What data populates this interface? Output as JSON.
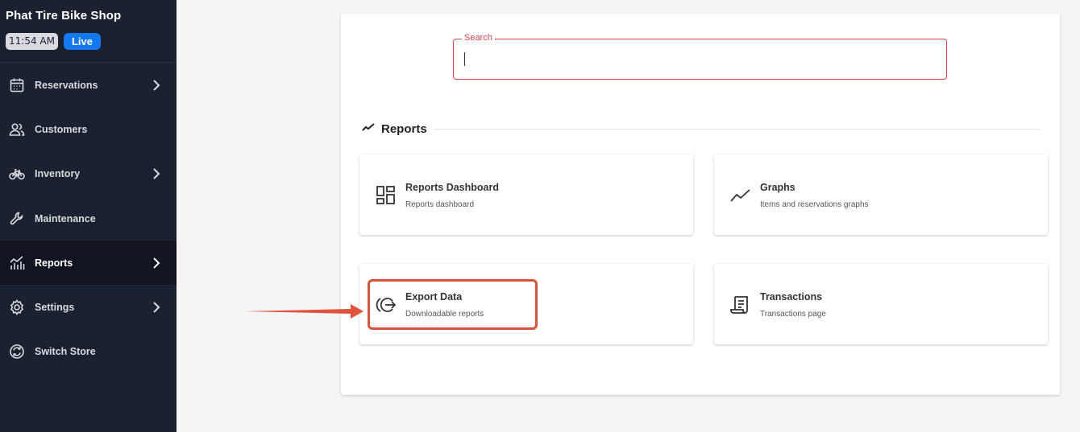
{
  "sidebar": {
    "brand": "Phat Tire Bike Shop",
    "clock": "11:54 AM",
    "status": "Live",
    "items": [
      {
        "label": "Reservations",
        "icon": "calendar-icon",
        "chevron": true
      },
      {
        "label": "Customers",
        "icon": "users-icon",
        "chevron": false
      },
      {
        "label": "Inventory",
        "icon": "bicycle-icon",
        "chevron": true
      },
      {
        "label": "Maintenance",
        "icon": "wrench-icon",
        "chevron": false
      },
      {
        "label": "Reports",
        "icon": "chart-icon",
        "chevron": true,
        "active": true
      },
      {
        "label": "Settings",
        "icon": "gear-icon",
        "chevron": true
      },
      {
        "label": "Switch Store",
        "icon": "switch-icon",
        "chevron": false
      }
    ]
  },
  "search": {
    "label": "Search",
    "value": ""
  },
  "reports": {
    "section_title": "Reports",
    "tiles": [
      {
        "title": "Reports Dashboard",
        "subtitle": "Reports dashboard",
        "icon": "dashboard-icon"
      },
      {
        "title": "Graphs",
        "subtitle": "Items and reservations graphs",
        "icon": "trend-icon"
      },
      {
        "title": "Export Data",
        "subtitle": "Downloadable reports",
        "icon": "export-icon"
      },
      {
        "title": "Transactions",
        "subtitle": "Transactions page",
        "icon": "receipt-icon"
      }
    ]
  },
  "colors": {
    "sidebar_bg": "#1c2130",
    "accent_live": "#1478f0",
    "search_border": "#d9464f",
    "highlight": "#d9523c"
  }
}
